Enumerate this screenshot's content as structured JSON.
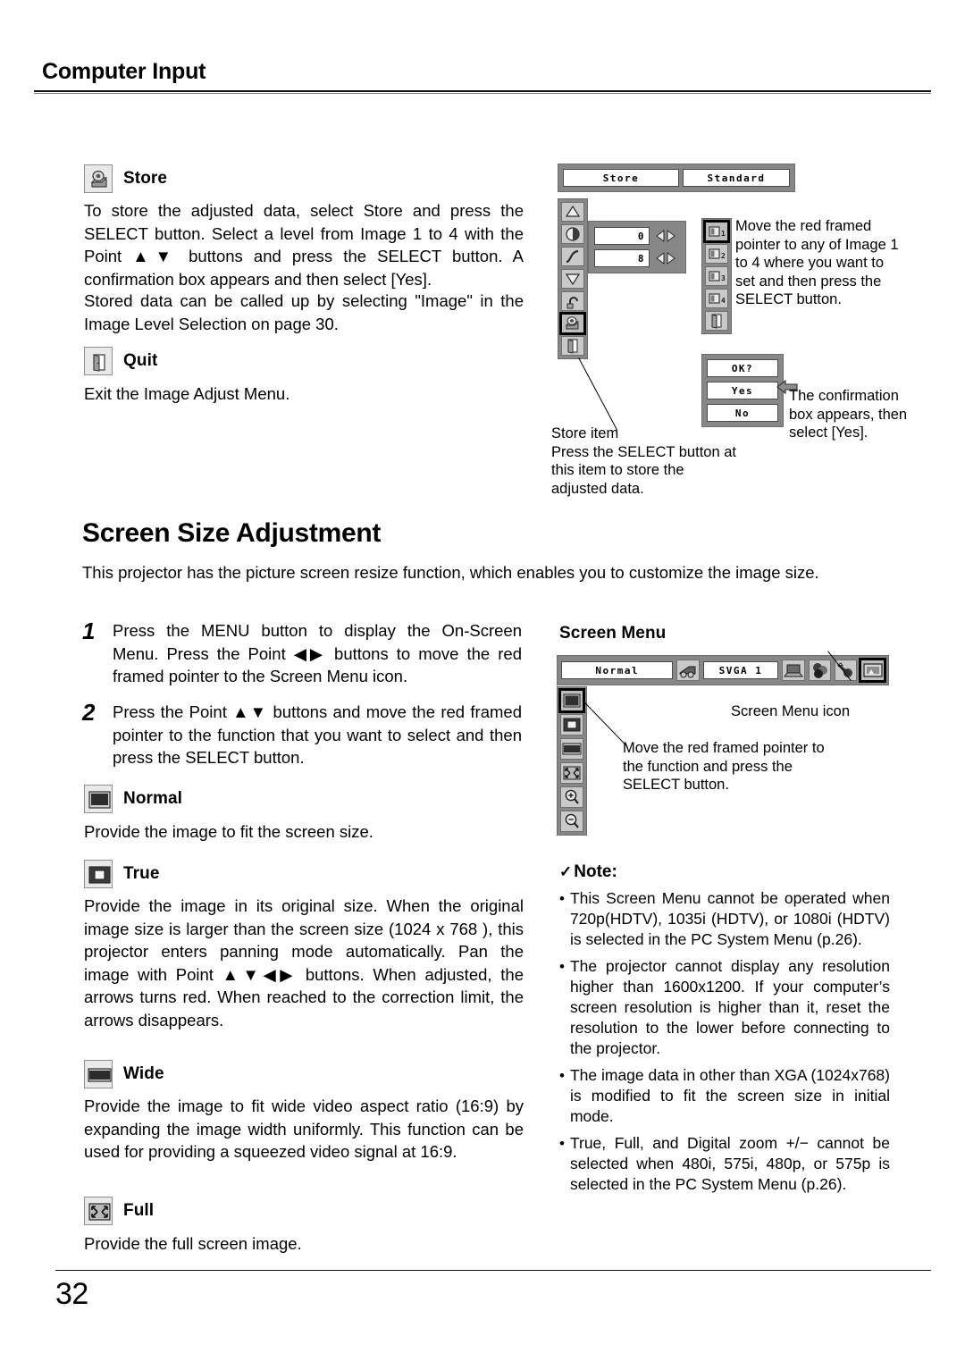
{
  "header": {
    "title": "Computer Input"
  },
  "store_section": {
    "heading": "Store",
    "icon": "store-disk-icon",
    "paragraphs": [
      "To store the adjusted data, select Store and press the SELECT button.  Select a level from Image 1 to 4 with the Point ▲▼ buttons and press the SELECT button.  A confirmation box appears and then select [Yes].",
      "Stored data can be called up by selecting \"Image\" in the Image Level Selection on page 30."
    ]
  },
  "quit_section": {
    "heading": "Quit",
    "icon": "door-exit-icon",
    "paragraph": "Exit the Image Adjust Menu."
  },
  "image_adjust_osd": {
    "top_buttons": [
      "Store",
      "Standard"
    ],
    "left_icons": [
      "triangle-up-icon",
      "contrast-circle-icon",
      "gamma-curve-icon",
      "triangle-down-icon",
      "reset-icon",
      "store-disk-icon",
      "door-exit-icon"
    ],
    "selected_left_icon": "store-disk-icon",
    "value_fields": [
      "0",
      "8"
    ],
    "image_level_icons": [
      "image-1-icon",
      "image-2-icon",
      "image-3-icon",
      "image-4-icon",
      "door-exit-icon"
    ],
    "selected_image_level": "image-1-icon",
    "confirm_box": {
      "title": "OK?",
      "yes": "Yes",
      "no": "No"
    },
    "callout_pointer": "Move the red framed pointer to any of Image 1 to 4 where you want to set and then press the SELECT button.",
    "callout_confirm": "The confirmation box appears, then select [Yes].",
    "callout_store_item": "Store item\nPress the SELECT button at this item to store the adjusted data."
  },
  "screen_size": {
    "title": "Screen Size Adjustment",
    "intro": "This projector has the picture screen resize function, which enables you to customize the image size.",
    "steps": [
      {
        "num": "1",
        "text": "Press the MENU button to display the On-Screen Menu.  Press the Point ◀▶ buttons to move the red framed pointer to the Screen Menu icon."
      },
      {
        "num": "2",
        "text": "Press the Point ▲▼ buttons and move the red framed pointer to the function that you want to select and then press the SELECT button."
      }
    ]
  },
  "screen_menu_osd": {
    "label": "Screen Menu",
    "mode_field": "Normal",
    "system_field": "SVGA 1",
    "top_icons": [
      "input-source-icon",
      "computer-icon",
      "color-adjust-icon",
      "image-adjust-icon",
      "screen-menu-icon"
    ],
    "selected_top_icon": "screen-menu-icon",
    "left_icons": [
      "normal-icon",
      "true-icon",
      "wide-icon",
      "full-icon",
      "digital-zoom-in-icon",
      "digital-zoom-out-icon"
    ],
    "selected_left_icon": "normal-icon",
    "callout_icon": "Screen Menu icon",
    "callout_pointer": "Move the red framed pointer to the function and press the SELECT button."
  },
  "functions": [
    {
      "heading": "Normal",
      "icon": "normal-icon",
      "text": "Provide the image to fit the screen size."
    },
    {
      "heading": "True",
      "icon": "true-icon",
      "text": "Provide the image in its original size. When the original image size is larger than the screen size (1024 x 768 ), this projector enters panning mode automatically. Pan the image with Point ▲▼◀▶ buttons.  When adjusted, the arrows turns red.  When reached to the correction limit, the arrows disappears."
    },
    {
      "heading": "Wide",
      "icon": "wide-icon",
      "text": "Provide the image to fit wide video aspect ratio (16:9) by expanding the image width uniformly.  This function can be used for providing a squeezed video signal at 16:9."
    },
    {
      "heading": "Full",
      "icon": "full-icon",
      "text": "Provide the full screen image."
    }
  ],
  "note": {
    "check": "✓",
    "heading": "Note:",
    "bullet": "•",
    "items": [
      "This  Screen  Menu  cannot  be operated when 720p(HDTV), 1035i (HDTV), or 1080i (HDTV) is selected in the PC System Menu (p.26).",
      "The projector cannot display any resolution higher than 1600x1200. If your computer’s screen resolution is higher than it, reset the resolution to the lower before connecting to the projector.",
      "The image data in other than XGA (1024x768) is modified to fit the screen size in initial mode.",
      "True,  Full,  and  Digital  zoom  +/− cannot be selected when 480i, 575i, 480p, or 575p is selected in the PC System Menu (p.26)."
    ]
  },
  "footer": {
    "page_number": "32"
  }
}
